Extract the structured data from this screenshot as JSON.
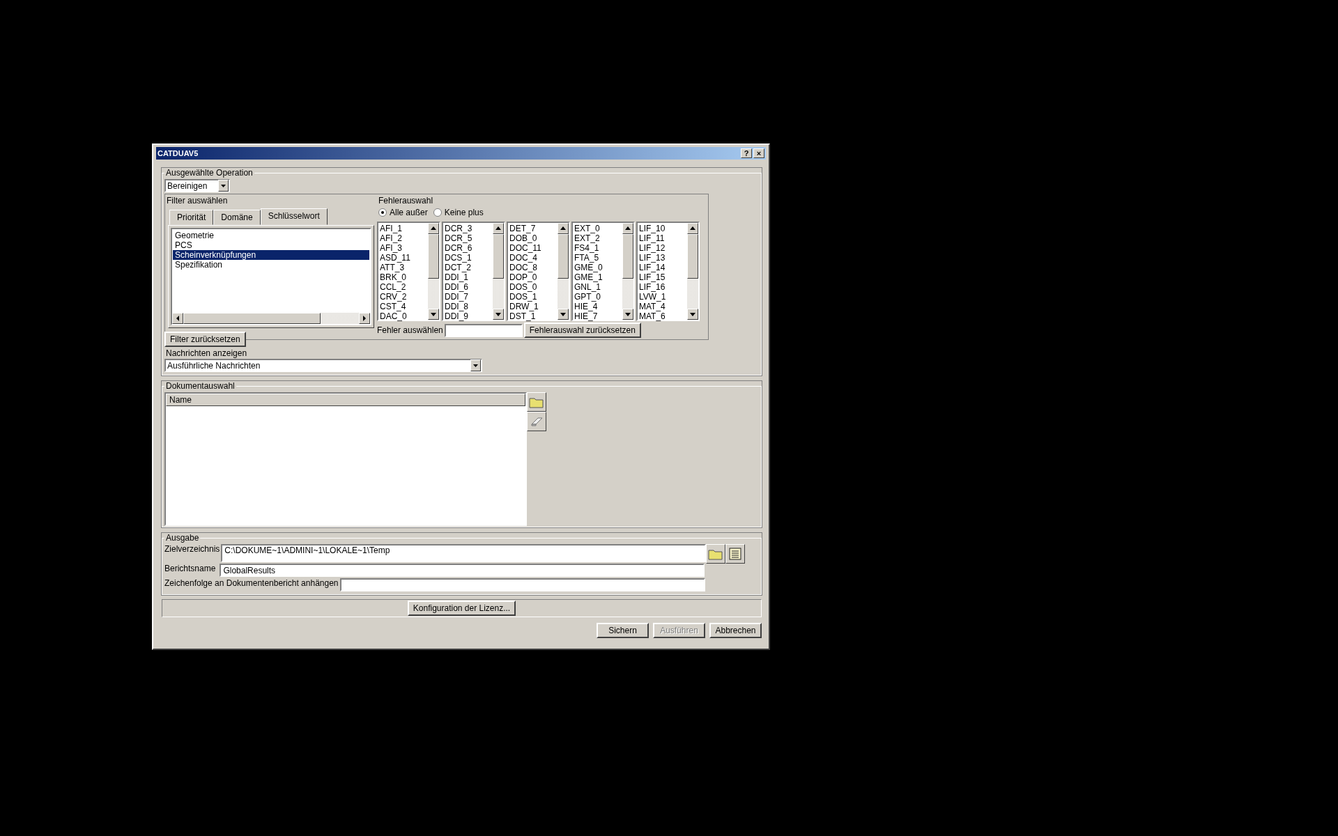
{
  "window": {
    "title": "CATDUAV5",
    "title_buttons": [
      "?",
      "×"
    ]
  },
  "operation": {
    "legend": "Ausgewählte Operation",
    "value": "Bereinigen"
  },
  "filter": {
    "label": "Filter auswählen",
    "tabs": [
      {
        "label": "Priorität",
        "selected": false
      },
      {
        "label": "Domäne",
        "selected": false
      },
      {
        "label": "Schlüsselwort",
        "selected": true
      }
    ],
    "items": [
      {
        "label": "Geometrie",
        "selected": false
      },
      {
        "label": "PCS",
        "selected": false
      },
      {
        "label": "Scheinverknüpfungen",
        "selected": true
      },
      {
        "label": "Spezifikation",
        "selected": false
      }
    ],
    "reset_button": "Filter zurücksetzen"
  },
  "error_selection": {
    "label": "Fehlerauswahl",
    "radios": [
      {
        "label": "Alle außer",
        "selected": true
      },
      {
        "label": "Keine plus",
        "selected": false
      }
    ],
    "lists": [
      [
        "AFI_1",
        "AFI_2",
        "AFI_3",
        "ASD_11",
        "ATT_3",
        "BRK_0",
        "CCL_2",
        "CRV_2",
        "CST_4",
        "DAC_0"
      ],
      [
        "DCR_3",
        "DCR_5",
        "DCR_6",
        "DCS_1",
        "DCT_2",
        "DDI_1",
        "DDI_6",
        "DDI_7",
        "DDI_8",
        "DDI_9"
      ],
      [
        "DET_7",
        "DOB_0",
        "DOC_11",
        "DOC_4",
        "DOC_8",
        "DOP_0",
        "DOS_0",
        "DOS_1",
        "DRW_1",
        "DST_1"
      ],
      [
        "EXT_0",
        "EXT_2",
        "FS4_1",
        "FTA_5",
        "GME_0",
        "GME_1",
        "GNL_1",
        "GPT_0",
        "HIE_4",
        "HIE_7"
      ],
      [
        "LIF_10",
        "LIF_11",
        "LIF_12",
        "LIF_13",
        "LIF_14",
        "LIF_15",
        "LIF_16",
        "LVW_1",
        "MAT_4",
        "MAT_6"
      ]
    ],
    "search_label": "Fehler auswählen",
    "reset_button": "Fehlerauswahl zurücksetzen"
  },
  "messages": {
    "label": "Nachrichten anzeigen",
    "value": "Ausführliche Nachrichten"
  },
  "documents": {
    "legend": "Dokumentauswahl",
    "columns": [
      "Name"
    ]
  },
  "output": {
    "legend": "Ausgabe",
    "fields": [
      {
        "label": "Zielverzeichnis",
        "value": "C:\\DOKUME~1\\ADMINI~1\\LOKALE~1\\Temp"
      },
      {
        "label": "Berichtsname",
        "value": "GlobalResults"
      },
      {
        "label": "Zeichenfolge an Dokumentenbericht anhängen"
      }
    ]
  },
  "license_button": "Konfiguration der Lizenz...",
  "buttons": [
    {
      "label": "Sichern",
      "disabled": false
    },
    {
      "label": "Ausführen",
      "disabled": true
    },
    {
      "label": "Abbrechen",
      "disabled": false
    }
  ]
}
